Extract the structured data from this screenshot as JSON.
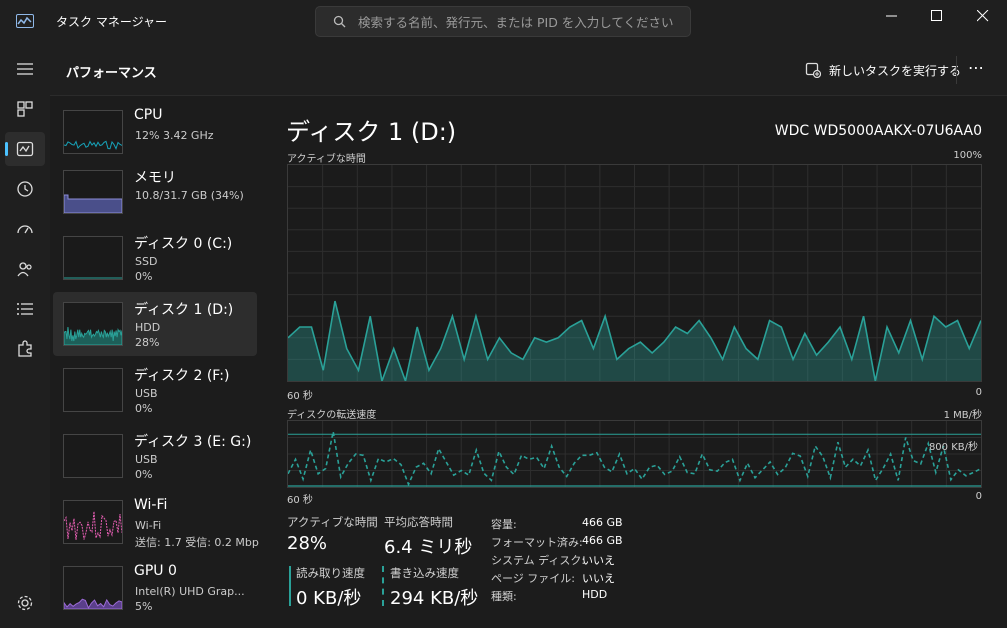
{
  "window": {
    "title": "タスク マネージャー",
    "search_placeholder": "検索する名前、発行元、または PID を入力してください"
  },
  "header": {
    "title": "パフォーマンス",
    "run_task_label": "新しいタスクを実行する",
    "more_label": "⋯"
  },
  "nav": [
    "hamburger-menu",
    "processes",
    "performance",
    "app-history",
    "startup-apps",
    "users",
    "details",
    "services",
    "settings"
  ],
  "devices": [
    {
      "name": "CPU",
      "line1": "12%  3.42 GHz",
      "line2": "",
      "color": "#17a2b8"
    },
    {
      "name": "メモリ",
      "line1": "10.8/31.7 GB (34%)",
      "line2": "",
      "color": "#8c8cd8"
    },
    {
      "name": "ディスク 0 (C:)",
      "line1": "SSD",
      "line2": "0%",
      "color": "#2aa198"
    },
    {
      "name": "ディスク 1 (D:)",
      "line1": "HDD",
      "line2": "28%",
      "color": "#2aa198"
    },
    {
      "name": "ディスク 2 (F:)",
      "line1": "USB",
      "line2": "0%",
      "color": "#2aa198"
    },
    {
      "name": "ディスク 3 (E: G:)",
      "line1": "USB",
      "line2": "0%",
      "color": "#2aa198"
    },
    {
      "name": "Wi-Fi",
      "line1": "Wi-Fi",
      "line2": "送信: 1.7  受信: 0.2 Mbps",
      "color": "#e85fb5"
    },
    {
      "name": "GPU 0",
      "line1": "Intel(R) UHD Grap...",
      "line2": "5%",
      "color": "#9b6bd6"
    }
  ],
  "main": {
    "title": "ディスク 1 (D:)",
    "model": "WDC WD5000AAKX-07U6AA0",
    "graph1": {
      "label": "アクティブな時間",
      "max": "100%",
      "time_left": "60 秒",
      "time_right": "0"
    },
    "graph2": {
      "label": "ディスクの転送速度",
      "max": "1 MB/秒",
      "ref": "800 KB/秒",
      "time_left": "60 秒",
      "time_right": "0"
    },
    "stats": {
      "active_label": "アクティブな時間",
      "active_value": "28%",
      "resp_label": "平均応答時間",
      "resp_value": "6.4 ミリ秒",
      "read_label": "読み取り速度",
      "read_value": "0 KB/秒",
      "write_label": "書き込み速度",
      "write_value": "294 KB/秒"
    },
    "props": [
      {
        "k": "容量:",
        "v": "466 GB"
      },
      {
        "k": "フォーマット済み:",
        "v": "466 GB"
      },
      {
        "k": "システム ディスク:",
        "v": "いいえ"
      },
      {
        "k": "ページ ファイル:",
        "v": "いいえ"
      },
      {
        "k": "種類:",
        "v": "HDD"
      }
    ]
  },
  "chart_data": [
    {
      "type": "area",
      "title": "アクティブな時間",
      "ylim": [
        0,
        100
      ],
      "values": [
        20,
        25,
        25,
        5,
        37,
        15,
        5,
        30,
        0,
        15,
        0,
        25,
        5,
        15,
        30,
        10,
        30,
        10,
        20,
        13,
        10,
        20,
        18,
        20,
        25,
        28,
        15,
        30,
        10,
        15,
        18,
        13,
        18,
        25,
        22,
        28,
        20,
        10,
        25,
        15,
        10,
        28,
        25,
        10,
        22,
        12,
        18,
        25,
        10,
        30,
        0,
        25,
        13,
        28,
        10,
        30,
        25,
        28,
        15,
        28
      ]
    },
    {
      "type": "line",
      "title": "ディスクの転送速度",
      "ylim": [
        0,
        1000
      ],
      "reference_value": 800,
      "values": [
        200,
        420,
        120,
        560,
        200,
        280,
        840,
        150,
        360,
        500,
        480,
        100,
        430,
        380,
        430,
        340,
        40,
        300,
        360,
        200,
        580,
        380,
        180,
        250,
        180,
        560,
        210,
        100,
        540,
        300,
        190,
        480,
        420,
        450,
        280,
        620,
        300,
        160,
        360,
        480,
        480,
        520,
        300,
        230,
        500,
        200,
        280,
        120,
        300,
        330,
        190,
        240,
        460,
        220,
        200,
        500,
        260,
        240,
        370,
        420,
        100,
        360,
        140,
        260,
        380,
        190,
        290,
        510,
        470,
        160,
        620,
        460,
        140,
        680,
        300,
        420,
        320,
        560,
        100,
        280,
        500,
        100,
        750,
        400,
        350,
        660,
        220,
        620,
        110,
        260,
        170,
        220,
        280
      ]
    }
  ]
}
